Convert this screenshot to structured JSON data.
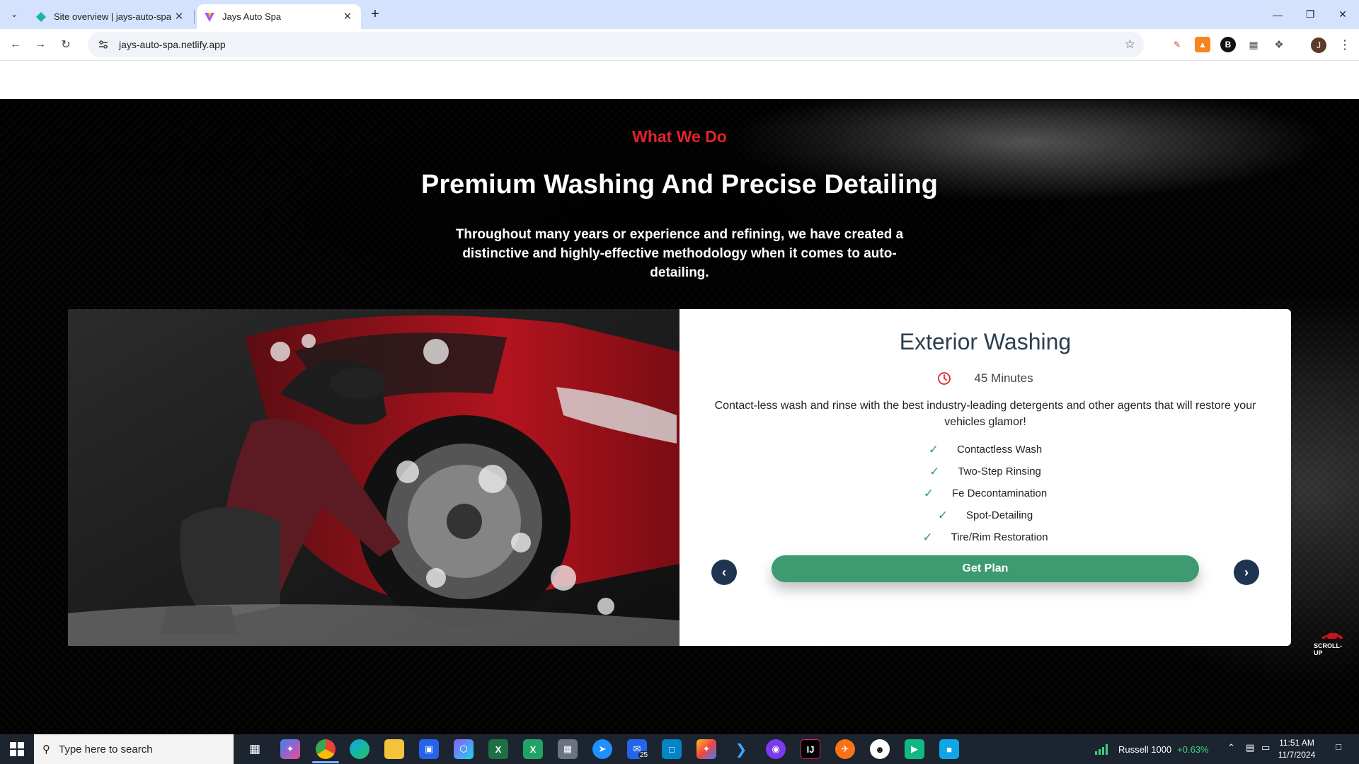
{
  "browser": {
    "tabs": [
      {
        "title": "Site overview | jays-auto-spa | N",
        "active": false
      },
      {
        "title": "Jays Auto Spa",
        "active": true
      }
    ],
    "url": "jays-auto-spa.netlify.app",
    "profile_initial": "J"
  },
  "section": {
    "eyebrow": "What We Do",
    "headline": "Premium Washing And Precise Detailing",
    "intro": "Throughout many years or experience and refining, we have created a distinctive and highly-effective methodology when it comes to auto-detailing."
  },
  "service": {
    "title": "Exterior Washing",
    "duration": "45 Minutes",
    "description": "Contact-less wash and rinse with the best industry-leading detergents and other agents that will restore your vehicles glamor!",
    "features": [
      "Contactless Wash",
      "Two-Step Rinsing",
      "Fe Decontamination",
      "Spot-Detailing",
      "Tire/Rim Restoration"
    ],
    "cta_label": "Get Plan"
  },
  "scroll_up": {
    "label": "SCROLL-UP"
  },
  "taskbar": {
    "search_placeholder": "Type here to search",
    "mail_badge": "25",
    "ticker_name": "Russell 1000",
    "ticker_change": "+0.63%",
    "time": "11:51 AM",
    "date": "11/7/2024"
  },
  "colors": {
    "accent_red": "#e3222c",
    "cta_green": "#3e9a70",
    "nav_dark": "#1f3450",
    "check_green": "#2f9e5e"
  }
}
